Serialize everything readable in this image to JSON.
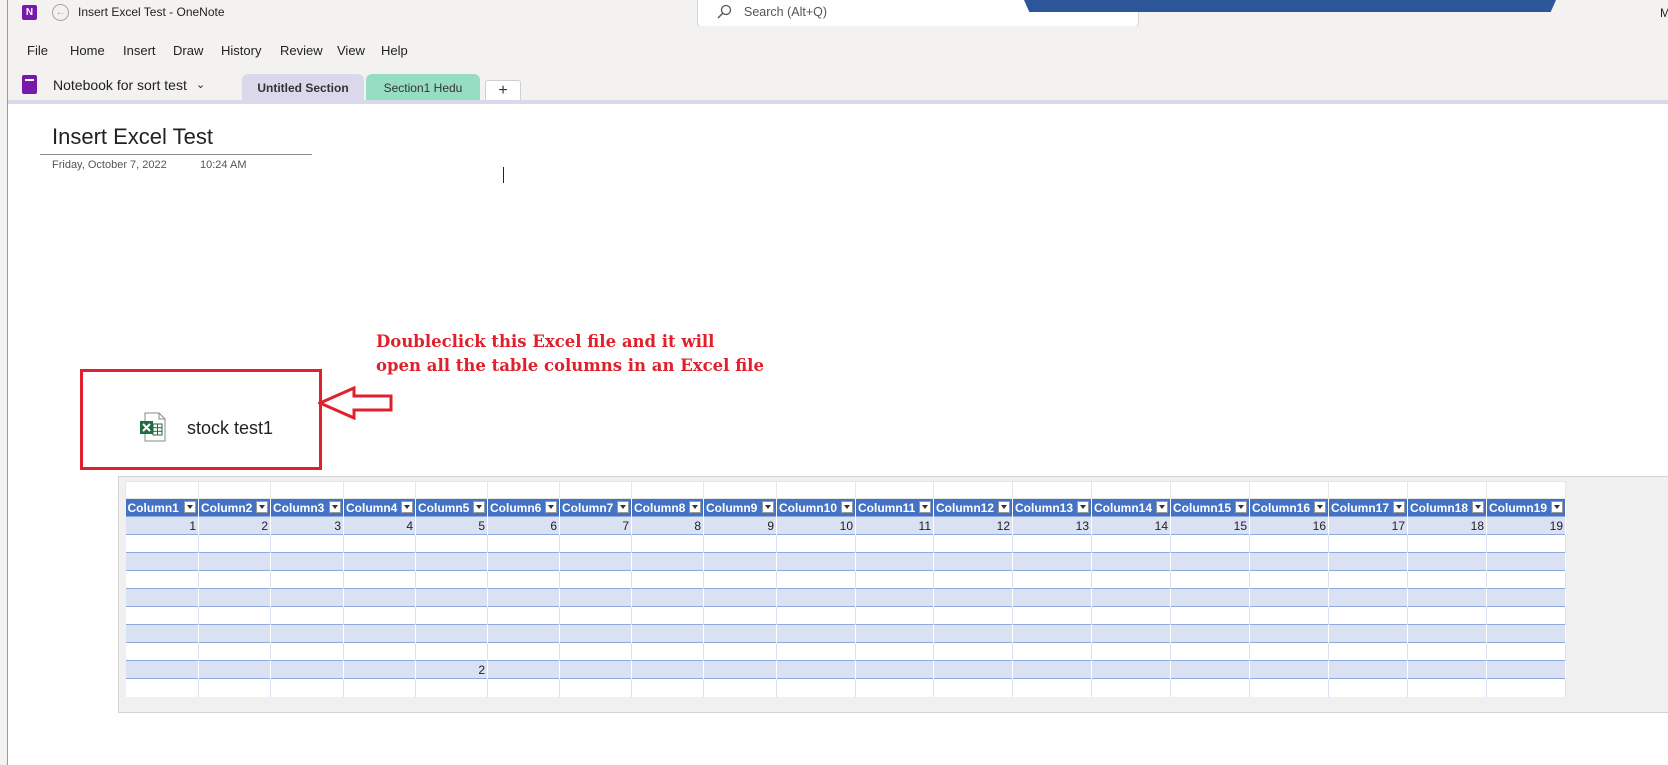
{
  "window": {
    "app_badge": "N",
    "title": "Insert Excel Test  -  OneNote",
    "search_placeholder": "Search (Alt+Q)",
    "user_initial": "M"
  },
  "menu": [
    "File",
    "Home",
    "Insert",
    "Draw",
    "History",
    "Review",
    "View",
    "Help"
  ],
  "notebook": {
    "name": "Notebook for sort test",
    "sections": [
      {
        "label": "Untitled Section",
        "color": "#dcd8ec",
        "active": true
      },
      {
        "label": "Section1 Hedu",
        "color": "#96ddc4",
        "active": false
      }
    ],
    "add_label": "+"
  },
  "page": {
    "title": "Insert Excel Test",
    "date": "Friday, October 7, 2022",
    "time": "10:24 AM"
  },
  "annotation": {
    "line1": "Doubleclick this Excel file and it will",
    "line2": "open all the table columns in an Excel file",
    "color": "#e0202c"
  },
  "attachment": {
    "name": "stock test1",
    "icon": "excel-file-icon"
  },
  "table": {
    "headers": [
      "Column1",
      "Column2",
      "Column3",
      "Column4",
      "Column5",
      "Column6",
      "Column7",
      "Column8",
      "Column9",
      "Column10",
      "Column11",
      "Column12",
      "Column13",
      "Column14",
      "Column15",
      "Column16",
      "Column17",
      "Column18",
      "Column19"
    ],
    "rows": [
      [
        "1",
        "2",
        "3",
        "4",
        "5",
        "6",
        "7",
        "8",
        "9",
        "10",
        "11",
        "12",
        "13",
        "14",
        "15",
        "16",
        "17",
        "18",
        "19"
      ],
      [
        "",
        "",
        "",
        "",
        "",
        "",
        "",
        "",
        "",
        "",
        "",
        "",
        "",
        "",
        "",
        "",
        "",
        "",
        ""
      ],
      [
        "",
        "",
        "",
        "",
        "",
        "",
        "",
        "",
        "",
        "",
        "",
        "",
        "",
        "",
        "",
        "",
        "",
        "",
        ""
      ],
      [
        "",
        "",
        "",
        "",
        "",
        "",
        "",
        "",
        "",
        "",
        "",
        "",
        "",
        "",
        "",
        "",
        "",
        "",
        ""
      ],
      [
        "",
        "",
        "",
        "",
        "",
        "",
        "",
        "",
        "",
        "",
        "",
        "",
        "",
        "",
        "",
        "",
        "",
        "",
        ""
      ],
      [
        "",
        "",
        "",
        "",
        "",
        "",
        "",
        "",
        "",
        "",
        "",
        "",
        "",
        "",
        "",
        "",
        "",
        "",
        ""
      ],
      [
        "",
        "",
        "",
        "",
        "",
        "",
        "",
        "",
        "",
        "",
        "",
        "",
        "",
        "",
        "",
        "",
        "",
        "",
        ""
      ],
      [
        "",
        "",
        "",
        "",
        "",
        "",
        "",
        "",
        "",
        "",
        "",
        "",
        "",
        "",
        "",
        "",
        "",
        "",
        ""
      ],
      [
        "",
        "",
        "",
        "",
        "2",
        "",
        "",
        "",
        "",
        "",
        "",
        "",
        "",
        "",
        "",
        "",
        "",
        "",
        ""
      ],
      [
        "",
        "",
        "",
        "",
        "",
        "",
        "",
        "",
        "",
        "",
        "",
        "",
        "",
        "",
        "",
        "",
        "",
        "",
        ""
      ]
    ],
    "header_color": "#4472c4",
    "band_color": "#d9e1f2"
  }
}
